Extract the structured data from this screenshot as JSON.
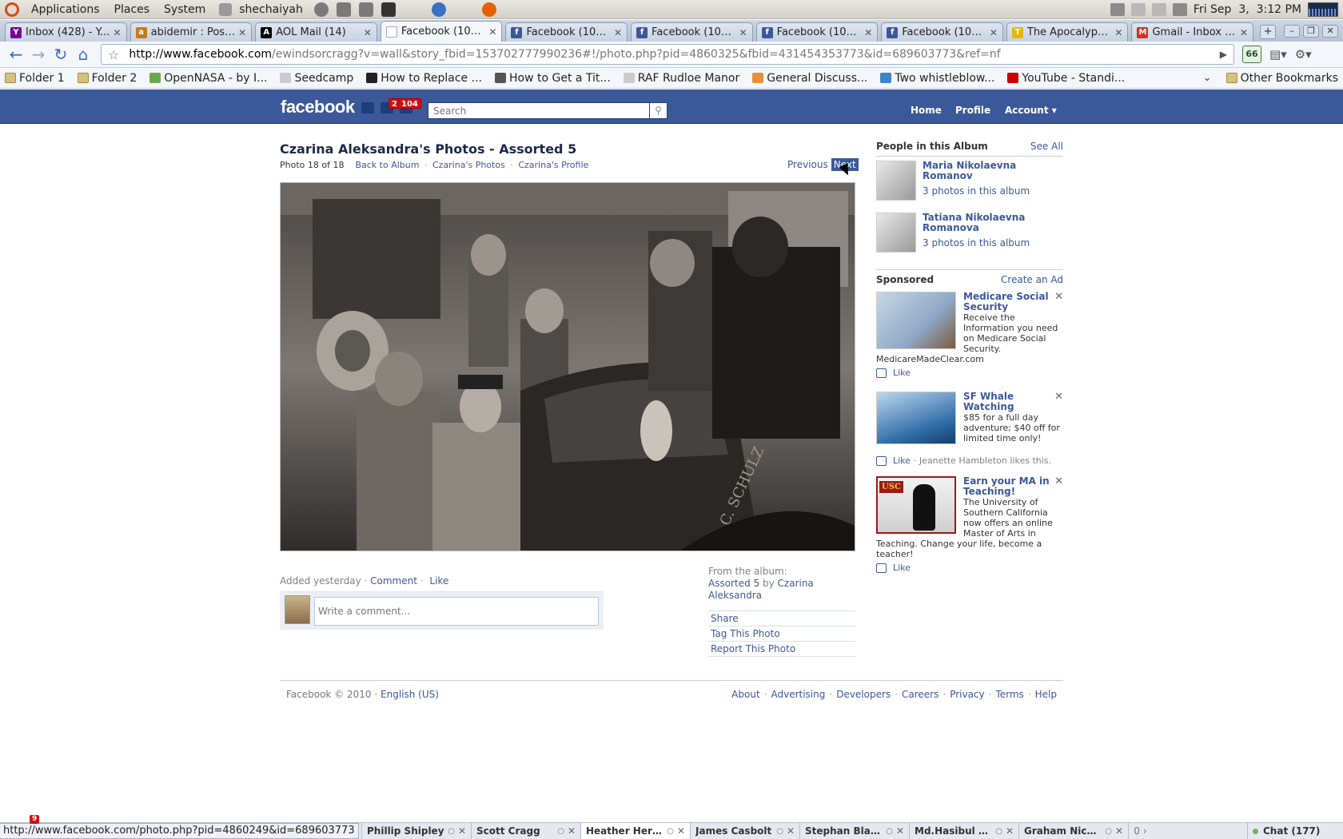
{
  "panel": {
    "menus": [
      "Applications",
      "Places",
      "System"
    ],
    "user": "shechaiyah",
    "clock": "Fri Sep  3,  3:12 PM"
  },
  "tabs": [
    {
      "title": "Inbox (428) - Y...",
      "color": "#7b0099",
      "glyph": "Y"
    },
    {
      "title": "abidemir : Post...",
      "color": "#c77a1d",
      "glyph": "a"
    },
    {
      "title": "AOL Mail (14)",
      "color": "#000000",
      "glyph": "A"
    },
    {
      "title": "Facebook (106...",
      "color": "#ffffff",
      "glyph": "",
      "active": true
    },
    {
      "title": "Facebook (105...",
      "color": "#3b5998",
      "glyph": "f"
    },
    {
      "title": "Facebook (106...",
      "color": "#3b5998",
      "glyph": "f"
    },
    {
      "title": "Facebook (106...",
      "color": "#3b5998",
      "glyph": "f"
    },
    {
      "title": "Facebook (106)...",
      "color": "#3b5998",
      "glyph": "f"
    },
    {
      "title": "The Apocalyps...",
      "color": "#e4b70e",
      "glyph": "T"
    },
    {
      "title": "Gmail - Inbox (...",
      "color": "#d93025",
      "glyph": "M"
    }
  ],
  "toolbar": {
    "url_host": "http://www.facebook.com",
    "url_path": "/ewindsorcragg?v=wall&story_fbid=153702777990236#!/photo.php?pid=4860325&fbid=431454353773&id=689603773&ref=nf",
    "ext_badge": "66"
  },
  "bookmarks": [
    {
      "label": "Folder 1",
      "folder": true
    },
    {
      "label": "Folder 2",
      "folder": true
    },
    {
      "label": "OpenNASA - by I...",
      "color": "#6aa84f"
    },
    {
      "label": "Seedcamp",
      "color": "#cccccc"
    },
    {
      "label": "How to Replace ...",
      "color": "#222222"
    },
    {
      "label": "How to Get a Tit...",
      "color": "#555555"
    },
    {
      "label": "RAF Rudloe Manor",
      "color": "#cccccc"
    },
    {
      "label": "General Discuss...",
      "color": "#e69138"
    },
    {
      "label": "Two whistleblow...",
      "color": "#3d85c6"
    },
    {
      "label": "YouTube - Standi...",
      "color": "#cc0000"
    }
  ],
  "bookmarks_other": "Other Bookmarks",
  "fb": {
    "logo": "facebook",
    "badge_messages": "2",
    "badge_notifications": "104",
    "search_placeholder": "Search",
    "nav": [
      "Home",
      "Profile",
      "Account ▾"
    ]
  },
  "photo": {
    "title": "Czarina Aleksandra's Photos - Assorted 5",
    "position": "Photo 18 of 18",
    "links": [
      "Back to Album",
      "Czarina's Photos",
      "Czarina's Profile"
    ],
    "previous": "Previous",
    "next": "Next",
    "added": "Added yesterday",
    "comment": "Comment",
    "like": "Like",
    "comment_placeholder": "Write a comment...",
    "from_album_label": "From the album:",
    "album_name": "Assorted 5",
    "by": "by",
    "album_owner": "Czarina Aleksandra",
    "actions": [
      "Share",
      "Tag This Photo",
      "Report This Photo"
    ]
  },
  "people": {
    "heading": "People in this Album",
    "see_all": "See All",
    "items": [
      {
        "name": "Maria Nikolaevna Romanov",
        "count": "3 photos in this album"
      },
      {
        "name": "Tatiana Nikolaevna Romanova",
        "count": "3 photos in this album"
      }
    ]
  },
  "sponsored": {
    "heading": "Sponsored",
    "create_ad": "Create an Ad",
    "ads": [
      {
        "title": "Medicare Social Security",
        "body": "Receive the Information you need on Medicare Social Security. MedicareMadeClear.com",
        "like": "Like",
        "social": "",
        "color": "#8fa9c8"
      },
      {
        "title": "SF Whale Watching",
        "body": "$85 for a full day adventure; $40 off for limited time only!",
        "like": "Like",
        "social": "· Jeanette Hambleton likes this.",
        "color": "#2d6aa6"
      },
      {
        "title": "Earn your MA in Teaching!",
        "body": "The University of Southern California now offers an online Master of Arts in Teaching. Change your life, become a teacher!",
        "like": "Like",
        "social": "",
        "color": "#9c1a1a",
        "badge": "USC"
      }
    ]
  },
  "footer": {
    "copyright": "Facebook © 2010 ·",
    "language": "English (US)",
    "links": [
      "About",
      "Advertising",
      "Developers",
      "Careers",
      "Privacy",
      "Terms",
      "Help"
    ]
  },
  "status_url": "http://www.facebook.com/photo.php?pid=4860249&id=689603773",
  "chat": {
    "notif": "9",
    "tabs": [
      "Phillip Shipley",
      "Scott Cragg",
      "Heather Herron...",
      "James Casbolt",
      "Stephan Blanke",
      "Md.Hasibul Has...",
      "Graham Nicholson"
    ],
    "active": "Heather Herron...",
    "overflow": "0",
    "main": "Chat (177)"
  }
}
